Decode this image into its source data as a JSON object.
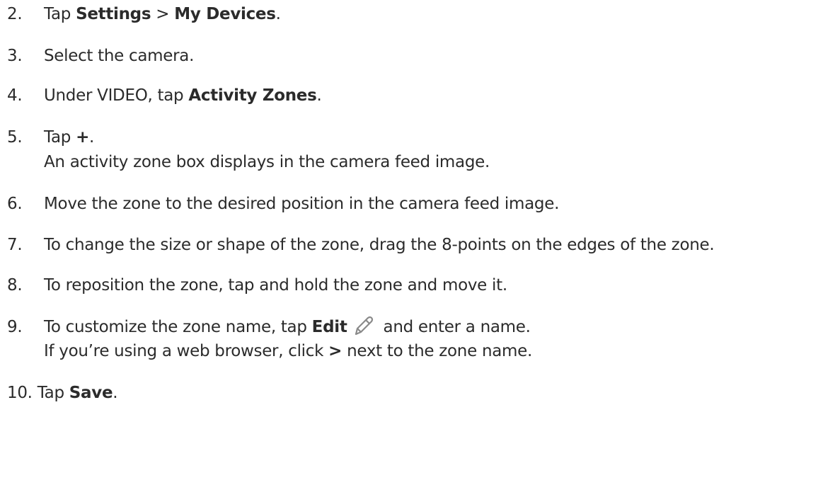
{
  "steps": [
    {
      "num": "2.",
      "pre": "Tap ",
      "b1": "Settings",
      "mid": " > ",
      "b2": "My Devices",
      "post": "."
    },
    {
      "num": "3.",
      "text": "Select the camera."
    },
    {
      "num": "4.",
      "pre": "Under VIDEO, tap ",
      "b1": "Activity Zones",
      "post": "."
    },
    {
      "num": "5.",
      "pre": "Tap ",
      "b1": "+",
      "post": ".",
      "sub": "An activity zone box displays in the camera feed image."
    },
    {
      "num": "6.",
      "text": "Move the zone to the desired position in the camera feed image."
    },
    {
      "num": "7.",
      "text": "To change the size or shape of the zone, drag the 8-points on the edges of the zone."
    },
    {
      "num": "8.",
      "text": "To reposition the zone, tap and hold the zone and move it."
    },
    {
      "num": "9.",
      "pre": "To customize the zone name, tap ",
      "b1": "Edit",
      "post": " and enter a name.",
      "sub_pre": "If you’re using a web browser, click ",
      "sub_b": ">",
      "sub_post": " next to the zone name."
    },
    {
      "num": "10.",
      "pre": "Tap ",
      "b1": "Save",
      "post": "."
    }
  ],
  "icons": {
    "edit": "pencil-icon"
  },
  "colors": {
    "text": "#2b2b2b",
    "icon": "#8a8a8a"
  }
}
